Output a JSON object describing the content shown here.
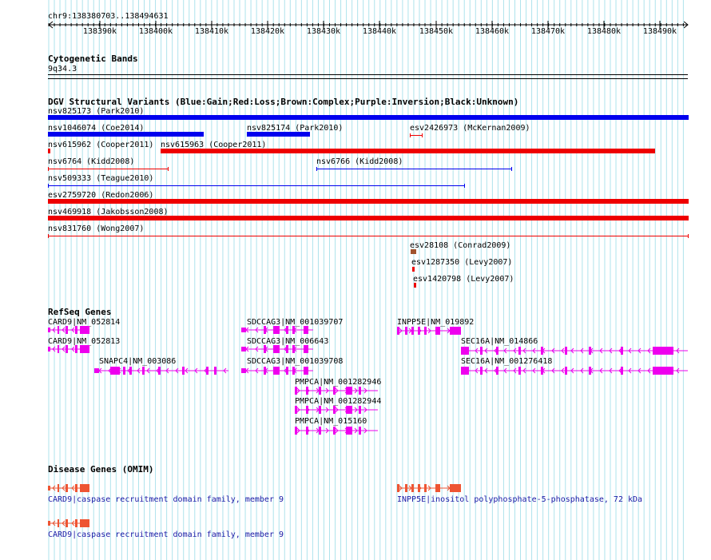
{
  "ruler": {
    "position": "chr9:138380703..138494631",
    "ticks": [
      "138390k",
      "138400k",
      "138410k",
      "138420k",
      "138430k",
      "138440k",
      "138450k",
      "138460k",
      "138470k",
      "138480k",
      "138490k"
    ]
  },
  "tracks": {
    "cytobands": {
      "title": "Cytogenetic Bands",
      "band": "9q34.3"
    },
    "dgv": {
      "title": "DGV Structural Variants (Blue:Gain;Red:Loss;Brown:Complex;Purple:Inversion;Black:Unknown)",
      "colors": {
        "gain": "#0000ee",
        "loss": "#ee0000",
        "complex": "#a0522d"
      },
      "variants": [
        {
          "label": "nsv825173 (Park2010)",
          "type": "gain",
          "style": "thick"
        },
        {
          "label": "nsv1046074 (Coe2014)",
          "type": "gain",
          "style": "thick"
        },
        {
          "label": "nsv825174 (Park2010)",
          "type": "gain",
          "style": "thick"
        },
        {
          "label": "esv2426973 (McKernan2009)",
          "type": "loss",
          "style": "thin"
        },
        {
          "label": "nsv615962 (Cooper2011)",
          "type": "loss",
          "style": "thick"
        },
        {
          "label": "nsv615963 (Cooper2011)",
          "type": "loss",
          "style": "thick"
        },
        {
          "label": "nsv6764 (Kidd2008)",
          "type": "loss",
          "style": "thin"
        },
        {
          "label": "nsv6766 (Kidd2008)",
          "type": "gain",
          "style": "thin"
        },
        {
          "label": "nsv509333 (Teague2010)",
          "type": "gain",
          "style": "thin"
        },
        {
          "label": "esv2759720 (Redon2006)",
          "type": "loss",
          "style": "thick"
        },
        {
          "label": "nsv469918 (Jakobsson2008)",
          "type": "loss",
          "style": "thick"
        },
        {
          "label": "nsv831760 (Wong2007)",
          "type": "loss",
          "style": "thin"
        },
        {
          "label": "esv28108 (Conrad2009)",
          "type": "complex",
          "style": "thick"
        },
        {
          "label": "esv1287350 (Levy2007)",
          "type": "loss",
          "style": "thick"
        },
        {
          "label": "esv1420798 (Levy2007)",
          "type": "loss",
          "style": "thick"
        }
      ]
    },
    "refseq": {
      "title": "RefSeq Genes",
      "color": "#ee00ee",
      "genes": [
        {
          "label": "CARD9|NM_052814"
        },
        {
          "label": "CARD9|NM_052813"
        },
        {
          "label": "SNAPC4|NM_003086"
        },
        {
          "label": "SDCCAG3|NM_001039707"
        },
        {
          "label": "SDCCAG3|NM_006643"
        },
        {
          "label": "SDCCAG3|NM_001039708"
        },
        {
          "label": "PMPCA|NM_001282946"
        },
        {
          "label": "PMPCA|NM_001282944"
        },
        {
          "label": "PMPCA|NM_015160"
        },
        {
          "label": "INPP5E|NM_019892"
        },
        {
          "label": "SEC16A|NM_014866"
        },
        {
          "label": "SEC16A|NM_001276418"
        }
      ]
    },
    "omim": {
      "title": "Disease Genes (OMIM)",
      "color": "#ee5533",
      "genes": [
        {
          "label": "CARD9|caspase recruitment domain family, member 9"
        },
        {
          "label": "INPP5E|inositol polyphosphate-5-phosphatase, 72 kDa"
        },
        {
          "label": "CARD9|caspase recruitment domain family, member 9"
        }
      ]
    }
  }
}
